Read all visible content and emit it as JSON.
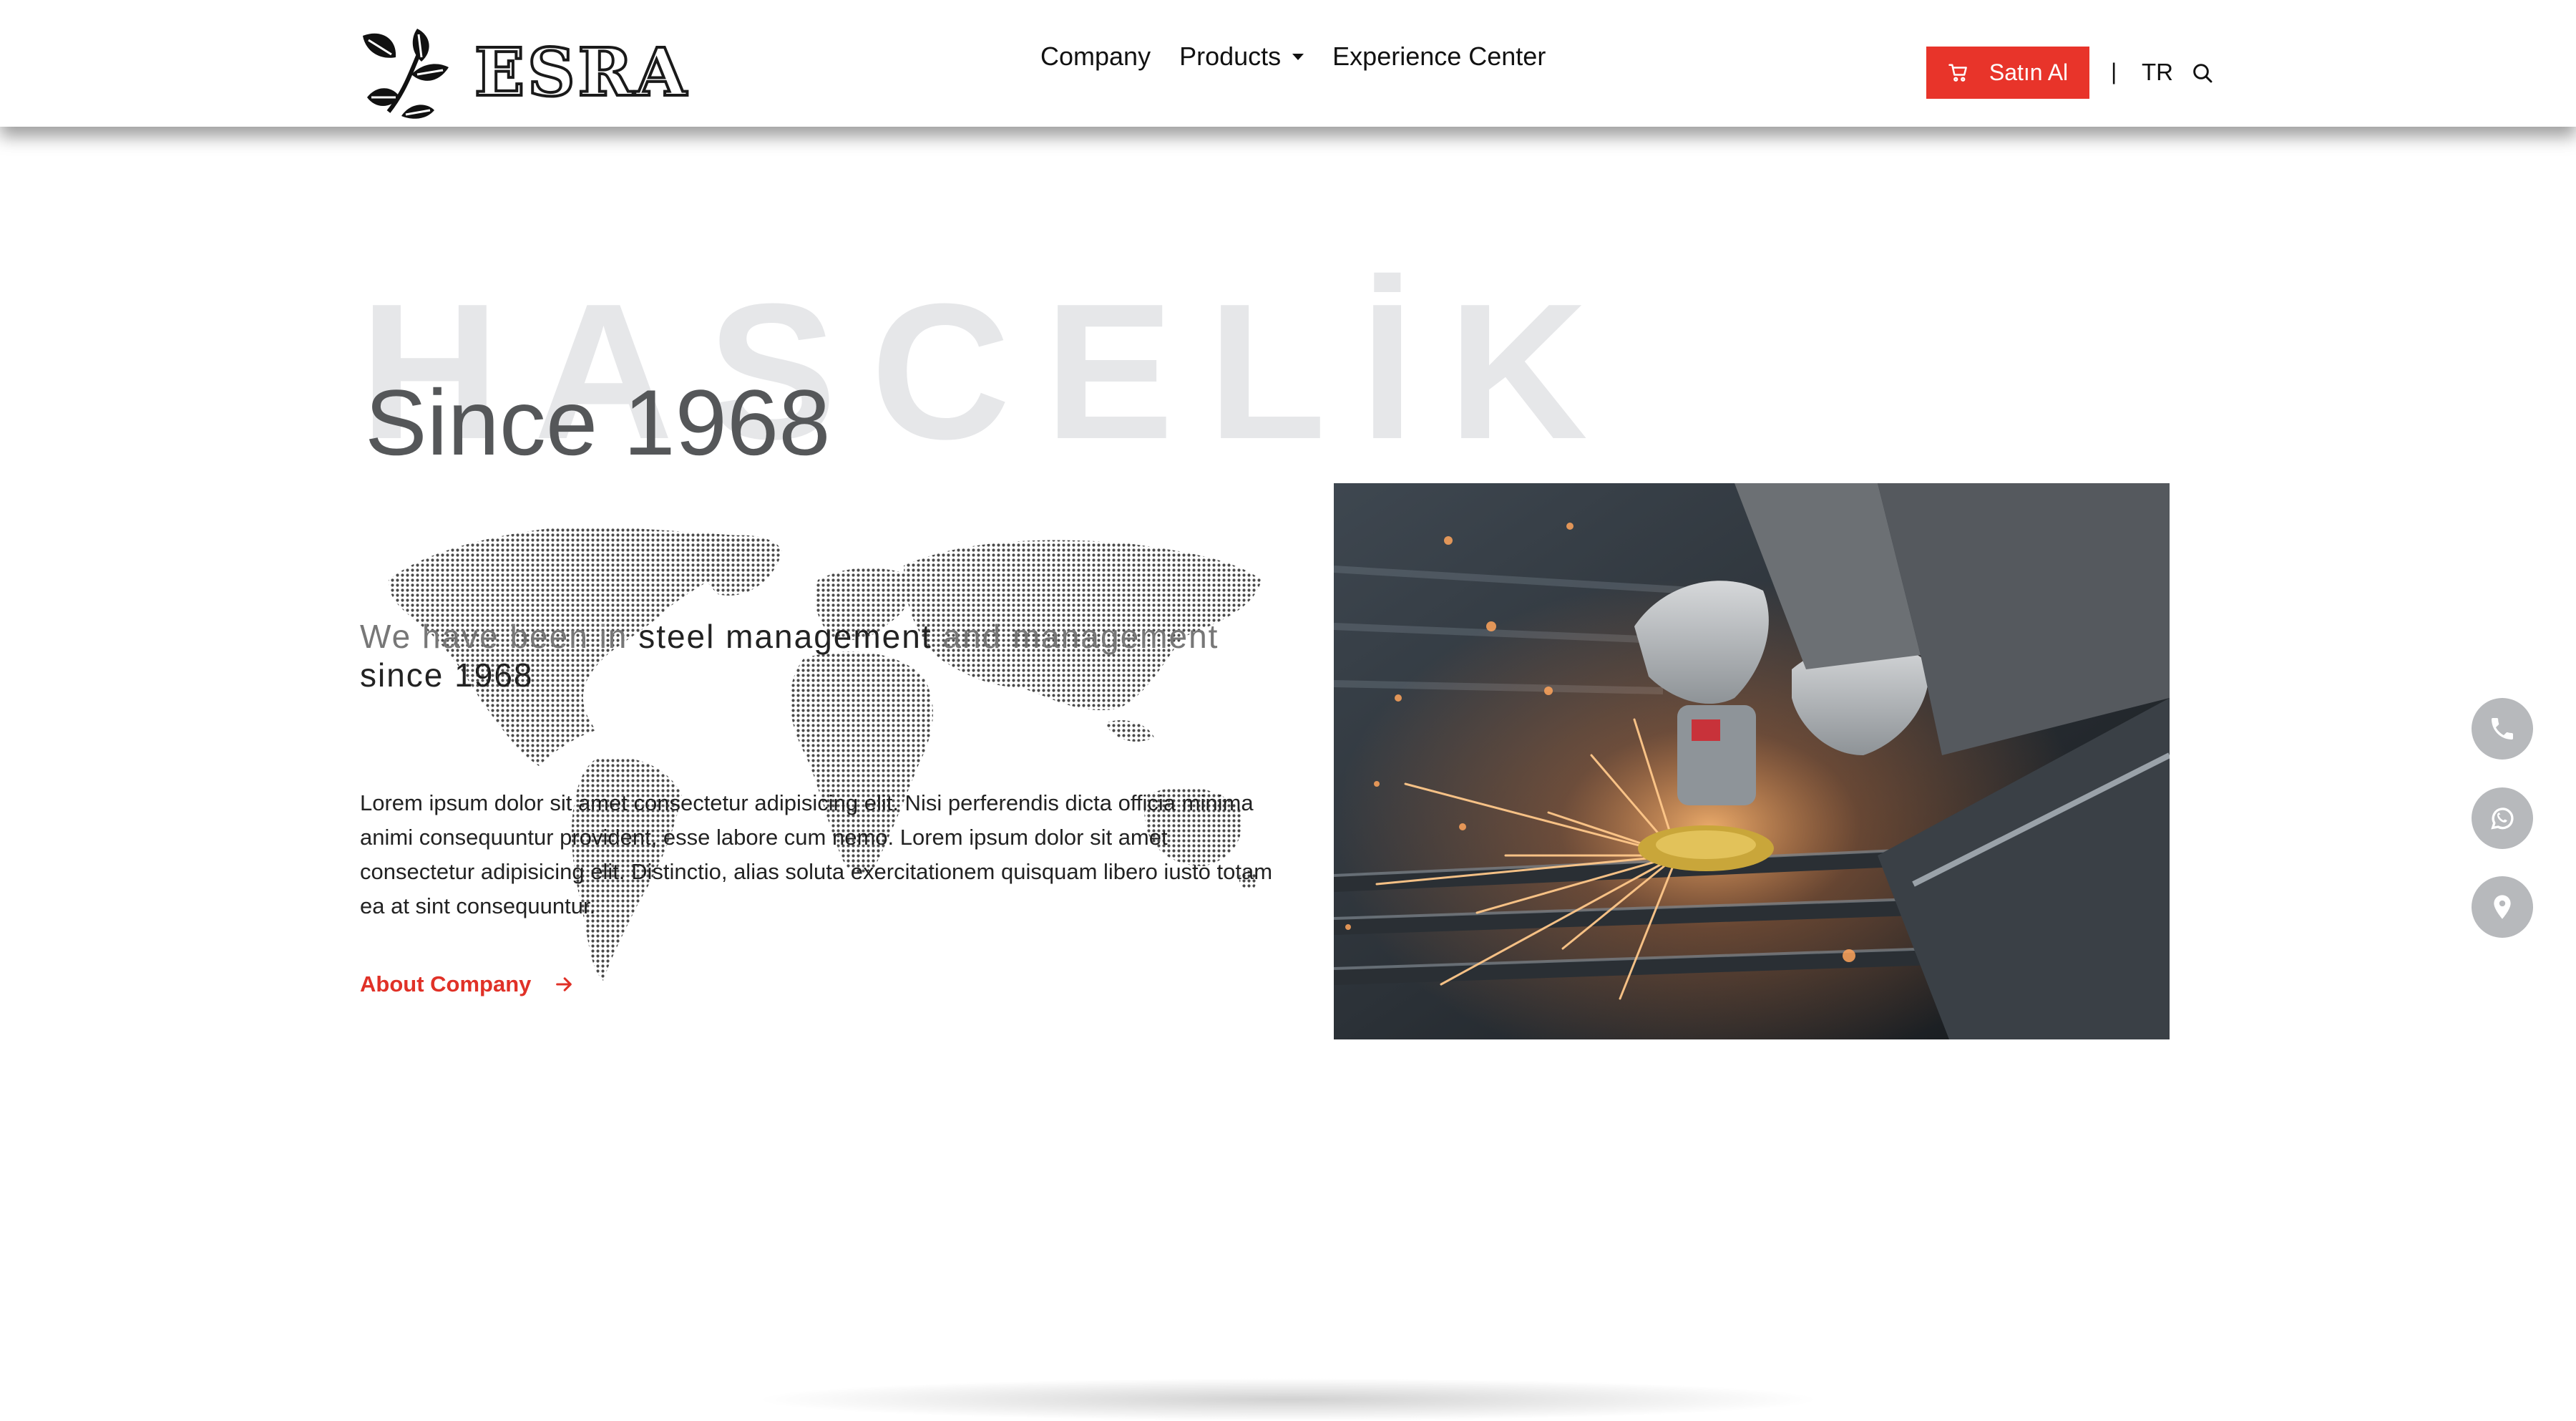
{
  "header": {
    "logo_text": "ESRA",
    "nav": [
      {
        "label": "Company"
      },
      {
        "label": "Products",
        "has_dropdown": true
      },
      {
        "label": "Experience Center"
      }
    ],
    "buy_button": "Satın Al",
    "separator": "|",
    "language": "TR",
    "icons": [
      "leaf-logo-icon",
      "cart-icon",
      "search-icon"
    ]
  },
  "hero": {
    "watermark": "HASCELİK",
    "heading": "Since 1968",
    "tagline": {
      "part1": "We have been in ",
      "bold1": "steel management",
      "part2": " and management ",
      "bold2": "since 1968"
    },
    "paragraph": "Lorem ipsum dolor sit amet consectetur adipisicing elit. Nisi perferendis dicta officia minima animi consequuntur provident, esse labore cum nemo. Lorem ipsum dolor sit amet consectetur adipisicing elit. Distinctio, alias soluta exercitationem quisquam libero iusto totam ea at sint consequuntur.",
    "link": "About Company",
    "image_subject": "worker grinding steel with sparks"
  },
  "floating_actions": [
    {
      "name": "phone",
      "icon": "phone-icon"
    },
    {
      "name": "whatsapp",
      "icon": "whatsapp-icon"
    },
    {
      "name": "location",
      "icon": "location-pin-icon"
    }
  ],
  "colors": {
    "accent": "#e8342a",
    "link": "#e03127",
    "watermark": "#e6e7e9",
    "heading": "#555759",
    "fab": "#b7b9bc"
  }
}
